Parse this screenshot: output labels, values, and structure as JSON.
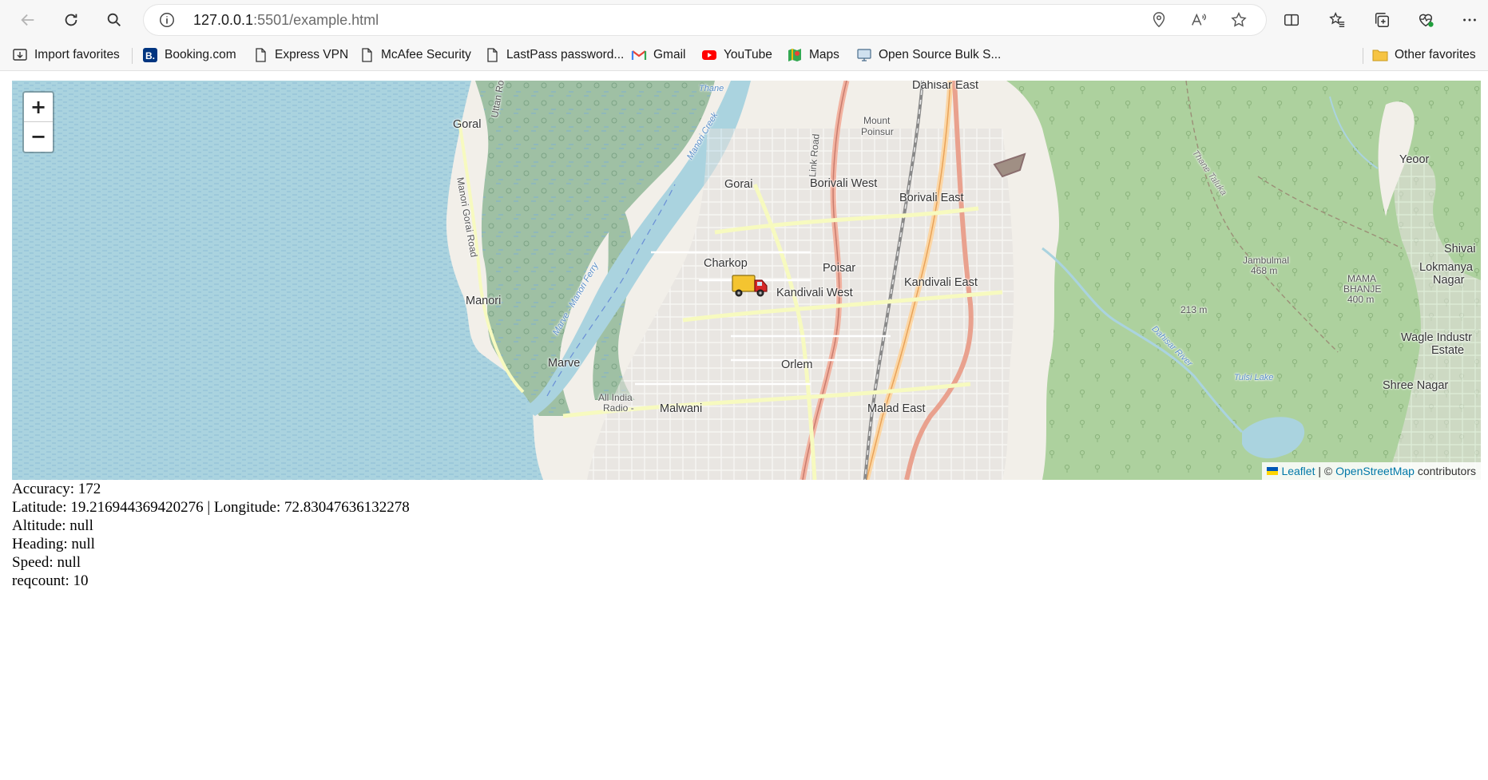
{
  "browser": {
    "address": {
      "host": "127.0.0.1",
      "path": ":5501/example.html"
    },
    "favorites": [
      {
        "label": "Import favorites",
        "icon": "import-icon"
      },
      {
        "label": "Booking.com",
        "icon": "booking-icon"
      },
      {
        "label": "Express VPN",
        "icon": "page-icon"
      },
      {
        "label": "McAfee Security",
        "icon": "page-icon"
      },
      {
        "label": "LastPass password...",
        "icon": "page-icon"
      },
      {
        "label": "Gmail",
        "icon": "gmail-icon"
      },
      {
        "label": "YouTube",
        "icon": "youtube-icon"
      },
      {
        "label": "Maps",
        "icon": "maps-icon"
      },
      {
        "label": "Open Source Bulk S...",
        "icon": "monitor-icon"
      }
    ],
    "other_favorites": "Other favorites"
  },
  "map": {
    "zoom_in": "+",
    "zoom_out": "−",
    "attribution": {
      "leaflet": "Leaflet",
      "sep": " | © ",
      "osm": "OpenStreetMap",
      "suffix": " contributors"
    },
    "labels": [
      {
        "text": "Dahisar East"
      },
      {
        "text": "Goral"
      },
      {
        "text": "Mount"
      },
      {
        "text": "Poinsur"
      },
      {
        "text": "Gorai"
      },
      {
        "text": "Borivali West"
      },
      {
        "text": "Borivali East"
      },
      {
        "text": "Yeoor"
      },
      {
        "text": "Shivai"
      },
      {
        "text": "Lokmanya"
      },
      {
        "text": "Nagar"
      },
      {
        "text": "Charkop"
      },
      {
        "text": "Poisar"
      },
      {
        "text": "Jambulmal"
      },
      {
        "text": "468 m"
      },
      {
        "text": "MAMA"
      },
      {
        "text": "BHANJE"
      },
      {
        "text": "400 m"
      },
      {
        "text": "Kandivali East"
      },
      {
        "text": "Kandivali West"
      },
      {
        "text": "Manori"
      },
      {
        "text": "213 m"
      },
      {
        "text": "Wagle Industr"
      },
      {
        "text": "Estate"
      },
      {
        "text": "Marve"
      },
      {
        "text": "Orlem"
      },
      {
        "text": "Tulsi Lake"
      },
      {
        "text": "Shree Nagar"
      },
      {
        "text": "All India"
      },
      {
        "text": "Radio -"
      },
      {
        "text": "Malwani"
      },
      {
        "text": "Malad East"
      },
      {
        "text": "Thane"
      },
      {
        "text": "Thane Taluka"
      },
      {
        "text": "Manori Creek"
      },
      {
        "text": "Marve - Manori Ferry"
      },
      {
        "text": "Dahisar River"
      },
      {
        "text": "Link Road"
      },
      {
        "text": "Uttan Road"
      },
      {
        "text": "Manori Gorai Road"
      }
    ],
    "marker": "delivery-truck-icon",
    "colors": {
      "sea": "#aad3df",
      "mangrove": "#9fc0a4",
      "forest": "#add19e",
      "land": "#f2efe9",
      "urban": "#e0dfdf"
    }
  },
  "info": {
    "accuracy": "Accuracy: 172",
    "latlng": "Latitude: 19.216944369420276 | Longitude: 72.83047636132278",
    "altitude": "Altitude: null",
    "heading": "Heading: null",
    "speed": "Speed: null",
    "reqcount": "reqcount: 10"
  }
}
